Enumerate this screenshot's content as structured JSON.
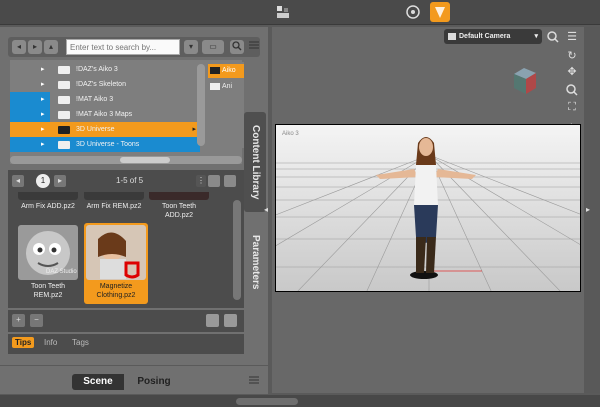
{
  "search": {
    "placeholder": "Enter text to search by..."
  },
  "tree": {
    "items": [
      {
        "label": "!DAZ's Aiko 3",
        "state": "normal"
      },
      {
        "label": "!DAZ's Skeleton",
        "state": "normal"
      },
      {
        "label": "!MAT Aiko 3",
        "state": "normal"
      },
      {
        "label": "!MAT Aiko 3 Maps",
        "state": "normal"
      },
      {
        "label": "3D Universe",
        "state": "selected-orange"
      },
      {
        "label": "3D Universe - Toons",
        "state": "selected-blue"
      }
    ],
    "right_items": [
      "Aiko",
      "Ani"
    ]
  },
  "pager": {
    "page": "1",
    "count": "1-5 of 5"
  },
  "content": {
    "items": [
      {
        "caption": "Arm Fix ADD.pz2",
        "selected": false
      },
      {
        "caption": "Arm Fix REM.pz2",
        "selected": false
      },
      {
        "caption": "Toon Teeth ADD.pz2",
        "selected": false
      },
      {
        "caption": "Toon Teeth REM.pz2",
        "selected": false
      },
      {
        "caption": "Magnetize Clothing.pz2",
        "selected": true
      }
    ],
    "thumb_overlay": "DAZ Studio"
  },
  "tips_tabs": [
    "Tips",
    "Info",
    "Tags"
  ],
  "side_tabs": [
    "Content Library",
    "Parameters"
  ],
  "bottom_tabs": [
    "Scene",
    "Posing"
  ],
  "viewport": {
    "camera": "Default Camera",
    "scene_label": "Aiko 3"
  },
  "colors": {
    "accent_orange": "#f39a1d",
    "accent_blue": "#1a8bd0",
    "panel": "#707070",
    "dark": "#4c4c4c"
  }
}
